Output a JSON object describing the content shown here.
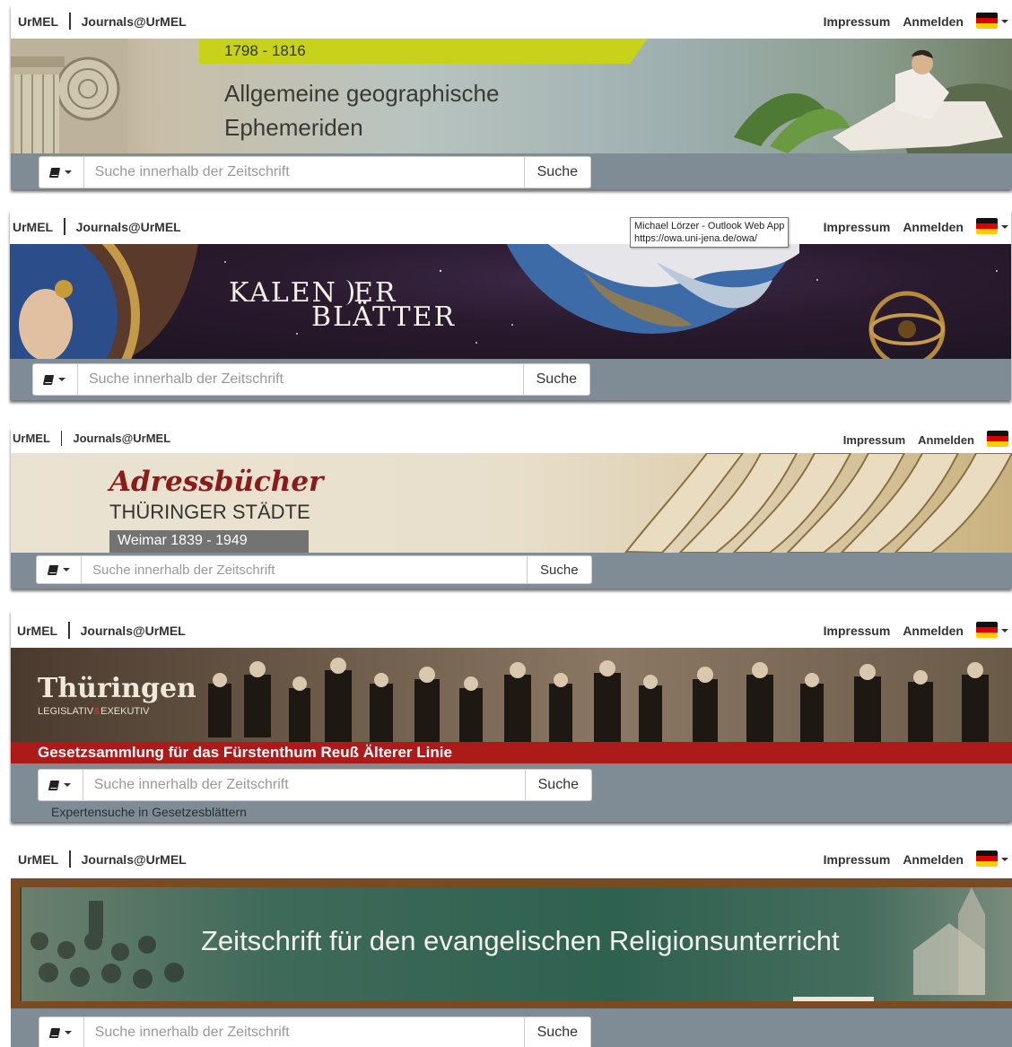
{
  "header": {
    "brand_left": "UrMEL",
    "brand_right": "Journals@UrMEL",
    "nav_impressum": "Impressum",
    "nav_anmelden": "Anmelden"
  },
  "search": {
    "placeholder": "Suche innerhalb der Zeitschrift",
    "button": "Suche"
  },
  "panels": [
    {
      "years": "1798 - 1816",
      "title_line1": "Allgemeine geographische",
      "title_line2": "Ephemeriden"
    },
    {
      "title_line1": "KALEN",
      "title_line1b": "ER",
      "title_line2": "BLÄTTER"
    },
    {
      "title": "Adressbücher",
      "subtitle": "THÜRINGER STÄDTE",
      "place": "Weimar 1839 - 1949"
    },
    {
      "logo": "Thüringen",
      "logo_sub1": "LEGISLATIV",
      "logo_amp": "&",
      "logo_sub2": "EXEKUTIV",
      "red_title": "Gesetzsammlung für das Fürstenthum Reuß Älterer Linie",
      "expert_link": "Expertensuche in Gesetzesblättern"
    },
    {
      "title": "Zeitschrift für den evangelischen Religionsunterricht"
    }
  ],
  "tooltip": {
    "line1": "Michael Lörzer - Outlook Web App",
    "line2": "https://owa.uni-jena.de/owa/"
  },
  "colors": {
    "search_bar": "#7f8c96",
    "year_band": "#c8d21a",
    "red_band": "#ad1a1a",
    "flag": [
      "#111111",
      "#dd0000",
      "#ffcc00"
    ]
  }
}
